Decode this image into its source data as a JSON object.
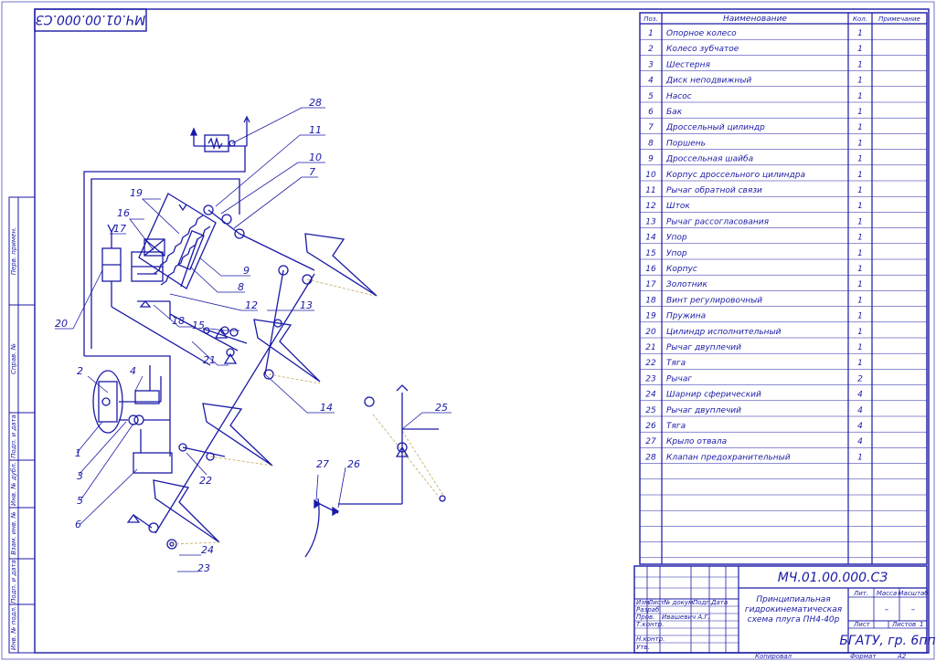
{
  "colors": {
    "ink": "#1a1aa6",
    "rod": "#2850d8",
    "ground": "#c8b070",
    "paper": "#ffffff"
  },
  "header": {
    "stamp_code": "МЧ.01.00.000.СЗ"
  },
  "side_strip": {
    "labels": [
      "Перв. примен.",
      "Справ. №",
      "Подп. и дата",
      "Инв. № дубл.",
      "Взам. инв. №",
      "Подп. и дата",
      "Инв. № подл."
    ]
  },
  "spec_table": {
    "headers": {
      "pos": "Поз.",
      "name": "Наименование",
      "qty": "Кол.",
      "note": "Примечание"
    },
    "rows": [
      {
        "pos": "1",
        "name": "Опорное колесо",
        "qty": "1"
      },
      {
        "pos": "2",
        "name": "Колесо зубчатое",
        "qty": "1"
      },
      {
        "pos": "3",
        "name": "Шестерня",
        "qty": "1"
      },
      {
        "pos": "4",
        "name": "Диск неподвижный",
        "qty": "1"
      },
      {
        "pos": "5",
        "name": "Насос",
        "qty": "1"
      },
      {
        "pos": "6",
        "name": "Бак",
        "qty": "1"
      },
      {
        "pos": "7",
        "name": "Дроссельный цилиндр",
        "qty": "1"
      },
      {
        "pos": "8",
        "name": "Поршень",
        "qty": "1"
      },
      {
        "pos": "9",
        "name": "Дроссельная шайба",
        "qty": "1"
      },
      {
        "pos": "10",
        "name": "Корпус дроссельного цилиндра",
        "qty": "1"
      },
      {
        "pos": "11",
        "name": "Рычаг обратной связи",
        "qty": "1"
      },
      {
        "pos": "12",
        "name": "Шток",
        "qty": "1"
      },
      {
        "pos": "13",
        "name": "Рычаг рассогласования",
        "qty": "1"
      },
      {
        "pos": "14",
        "name": "Упор",
        "qty": "1"
      },
      {
        "pos": "15",
        "name": "Упор",
        "qty": "1"
      },
      {
        "pos": "16",
        "name": "Корпус",
        "qty": "1"
      },
      {
        "pos": "17",
        "name": "Золотник",
        "qty": "1"
      },
      {
        "pos": "18",
        "name": "Винт регулировочный",
        "qty": "1"
      },
      {
        "pos": "19",
        "name": "Пружина",
        "qty": "1"
      },
      {
        "pos": "20",
        "name": "Цилиндр исполнительный",
        "qty": "1"
      },
      {
        "pos": "21",
        "name": "Рычаг двуплечий",
        "qty": "1"
      },
      {
        "pos": "22",
        "name": "Тяга",
        "qty": "1"
      },
      {
        "pos": "23",
        "name": "Рычаг",
        "qty": "2"
      },
      {
        "pos": "24",
        "name": "Шарнир сферический",
        "qty": "4"
      },
      {
        "pos": "25",
        "name": "Рычаг двуплечий",
        "qty": "4"
      },
      {
        "pos": "26",
        "name": "Тяга",
        "qty": "4"
      },
      {
        "pos": "27",
        "name": "Крыло отвала",
        "qty": "4"
      },
      {
        "pos": "28",
        "name": "Клапан предохранительный",
        "qty": "1"
      }
    ],
    "empty_rows": 7
  },
  "title_block": {
    "code": "МЧ.01.00.000.СЗ",
    "title_line1": "Принципиальная",
    "title_line2": "гидрокинематическая",
    "title_line3": "схема плуга ПН4-40р",
    "col_izm": "Изм.",
    "col_list": "Лист",
    "col_doc": "№ докум.",
    "col_podp": "Подп.",
    "col_data": "Дата",
    "row_razrab": "Разраб.",
    "row_prov": "Пров.",
    "row_tkontr": "Т.контр.",
    "row_nkontr": "Н.контр.",
    "row_utv": "Утв.",
    "author": "Ивашевич А.Г.",
    "lit": "Лит.",
    "massa": "Масса",
    "masshtab": "Масштаб",
    "massa_val": "–",
    "masshtab_val": "–",
    "sheet": "Лист",
    "sheets": "Листов",
    "sheets_val": "1",
    "org": "БГАТУ, гр. 6пп",
    "copied": "Копировал",
    "format": "Формат",
    "format_val": "А2"
  },
  "callouts": [
    "28",
    "11",
    "10",
    "7",
    "19",
    "16",
    "17",
    "9",
    "8",
    "12",
    "13",
    "20",
    "18",
    "15",
    "21",
    "14",
    "25",
    "2",
    "4",
    "1",
    "3",
    "5",
    "6",
    "22",
    "27",
    "26",
    "24",
    "23"
  ]
}
